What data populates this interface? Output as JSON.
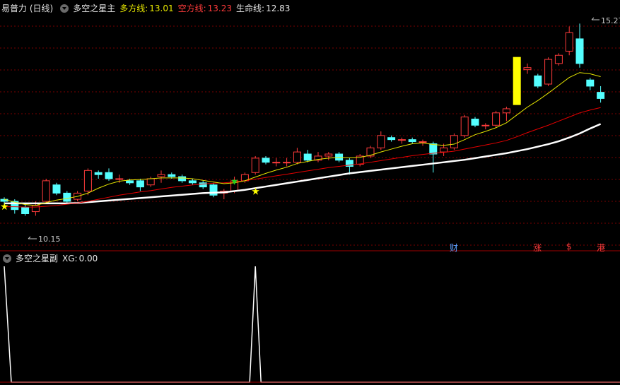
{
  "main_legend": {
    "title": "易普力 (日线)",
    "indicator": "多空之星主",
    "long_label": "多方线:",
    "long_value": "13.01",
    "short_label": "空方线:",
    "short_value": "13.23",
    "life_label": "生命线:",
    "life_value": "12.83"
  },
  "sub_legend": {
    "indicator": "多空之星副",
    "xg_label": "XG:",
    "xg_value": "0.00"
  },
  "price_labels": {
    "high": "15.27",
    "low": "10.15"
  },
  "event_tags": [
    {
      "text": "财",
      "color": "#5aa0ff"
    },
    {
      "text": "涨",
      "color": "#ff3b3b"
    },
    {
      "text": "$",
      "color": "#ff3b3b"
    },
    {
      "text": "港",
      "color": "#ff3b3b"
    }
  ],
  "colors": {
    "up": "#ff3b3b",
    "down": "#54ffff",
    "long_line": "#e6e600",
    "short_line": "#e60000",
    "life_line": "#ffffff",
    "grid": "#7a0000"
  },
  "chart_data": {
    "type": "candlestick",
    "y_range": [
      9.8,
      15.5
    ],
    "candles": [
      [
        11.0,
        10.95,
        10.85,
        11.05
      ],
      [
        10.95,
        10.75,
        10.65,
        11.0
      ],
      [
        10.8,
        10.65,
        10.6,
        10.9
      ],
      [
        10.7,
        10.85,
        10.6,
        10.95
      ],
      [
        10.95,
        11.45,
        10.9,
        11.5
      ],
      [
        11.35,
        11.15,
        11.1,
        11.4
      ],
      [
        11.15,
        10.95,
        10.9,
        11.2
      ],
      [
        11.0,
        11.15,
        10.95,
        11.2
      ],
      [
        11.2,
        11.7,
        11.1,
        11.75
      ],
      [
        11.65,
        11.6,
        11.5,
        11.7
      ],
      [
        11.65,
        11.5,
        11.45,
        11.75
      ],
      [
        11.5,
        11.5,
        11.4,
        11.6
      ],
      [
        11.45,
        11.4,
        11.35,
        11.5
      ],
      [
        11.45,
        11.3,
        11.2,
        11.5
      ],
      [
        11.35,
        11.5,
        11.3,
        11.55
      ],
      [
        11.55,
        11.6,
        11.4,
        11.7
      ],
      [
        11.6,
        11.55,
        11.5,
        11.65
      ],
      [
        11.55,
        11.45,
        11.4,
        11.6
      ],
      [
        11.45,
        11.4,
        11.35,
        11.5
      ],
      [
        11.4,
        11.3,
        11.25,
        11.45
      ],
      [
        11.35,
        11.1,
        11.05,
        11.4
      ],
      [
        11.15,
        11.2,
        11.0,
        11.25
      ],
      [
        11.2,
        11.45,
        11.15,
        11.55
      ],
      [
        11.45,
        11.6,
        11.4,
        11.65
      ],
      [
        11.65,
        12.0,
        11.6,
        12.05
      ],
      [
        12.0,
        11.9,
        11.85,
        12.05
      ],
      [
        11.9,
        11.9,
        11.8,
        12.0
      ],
      [
        11.9,
        11.9,
        11.8,
        12.0
      ],
      [
        11.9,
        12.15,
        11.85,
        12.25
      ],
      [
        12.1,
        11.95,
        11.9,
        12.2
      ],
      [
        11.95,
        12.05,
        11.9,
        12.15
      ],
      [
        12.05,
        12.1,
        11.95,
        12.15
      ],
      [
        12.1,
        11.95,
        11.9,
        12.15
      ],
      [
        11.95,
        11.8,
        11.6,
        12.0
      ],
      [
        11.85,
        12.05,
        11.8,
        12.1
      ],
      [
        12.05,
        12.25,
        12.0,
        12.3
      ],
      [
        12.25,
        12.55,
        12.2,
        12.65
      ],
      [
        12.5,
        12.45,
        12.4,
        12.55
      ],
      [
        12.45,
        12.45,
        12.35,
        12.5
      ],
      [
        12.45,
        12.4,
        12.35,
        12.5
      ],
      [
        12.4,
        12.4,
        12.3,
        12.45
      ],
      [
        12.35,
        12.1,
        11.65,
        12.4
      ],
      [
        12.15,
        12.25,
        12.05,
        12.35
      ],
      [
        12.25,
        12.55,
        12.2,
        12.6
      ],
      [
        12.55,
        13.0,
        12.5,
        13.05
      ],
      [
        12.95,
        12.8,
        12.75,
        13.0
      ],
      [
        12.8,
        12.8,
        12.7,
        12.85
      ],
      [
        12.8,
        13.1,
        12.75,
        13.15
      ],
      [
        13.1,
        13.2,
        12.9,
        13.25
      ],
      [
        13.3,
        14.45,
        13.3,
        14.45
      ],
      [
        14.15,
        14.2,
        14.05,
        14.3
      ],
      [
        14.0,
        13.75,
        13.7,
        14.05
      ],
      [
        13.8,
        14.4,
        13.75,
        14.45
      ],
      [
        14.3,
        14.5,
        14.25,
        14.55
      ],
      [
        14.6,
        15.05,
        14.5,
        15.2
      ],
      [
        14.9,
        14.3,
        14.2,
        15.27
      ],
      [
        13.9,
        13.75,
        13.65,
        13.95
      ],
      [
        13.6,
        13.45,
        13.35,
        13.75
      ]
    ],
    "long_line": [
      11.0,
      10.93,
      10.87,
      10.85,
      10.92,
      10.98,
      11.02,
      11.07,
      11.15,
      11.27,
      11.37,
      11.44,
      11.47,
      11.48,
      11.5,
      11.52,
      11.52,
      11.52,
      11.5,
      11.46,
      11.42,
      11.38,
      11.4,
      11.45,
      11.54,
      11.63,
      11.71,
      11.78,
      11.87,
      11.92,
      11.97,
      12.0,
      12.02,
      12.01,
      12.02,
      12.07,
      12.15,
      12.22,
      12.29,
      12.35,
      12.37,
      12.33,
      12.31,
      12.34,
      12.45,
      12.57,
      12.65,
      12.74,
      12.86,
      13.05,
      13.24,
      13.4,
      13.58,
      13.77,
      13.96,
      14.08,
      14.05,
      13.98
    ],
    "short_line": [
      10.82,
      10.82,
      10.81,
      10.81,
      10.83,
      10.85,
      10.88,
      10.91,
      10.95,
      11.0,
      11.05,
      11.1,
      11.14,
      11.18,
      11.21,
      11.25,
      11.29,
      11.32,
      11.35,
      11.37,
      11.39,
      11.4,
      11.42,
      11.45,
      11.49,
      11.53,
      11.57,
      11.61,
      11.65,
      11.69,
      11.73,
      11.77,
      11.8,
      11.83,
      11.86,
      11.9,
      11.94,
      11.98,
      12.02,
      12.06,
      12.09,
      12.12,
      12.14,
      12.17,
      12.22,
      12.27,
      12.32,
      12.37,
      12.43,
      12.52,
      12.62,
      12.71,
      12.8,
      12.9,
      13.0,
      13.1,
      13.17,
      13.23
    ],
    "life_line": [
      10.9,
      10.9,
      10.9,
      10.9,
      10.9,
      10.9,
      10.9,
      10.91,
      10.93,
      10.95,
      10.97,
      10.99,
      11.01,
      11.03,
      11.05,
      11.07,
      11.09,
      11.11,
      11.13,
      11.15,
      11.16,
      11.17,
      11.2,
      11.23,
      11.27,
      11.31,
      11.35,
      11.39,
      11.43,
      11.47,
      11.51,
      11.55,
      11.59,
      11.63,
      11.66,
      11.69,
      11.72,
      11.75,
      11.78,
      11.81,
      11.84,
      11.87,
      11.9,
      11.93,
      11.96,
      12.0,
      12.04,
      12.08,
      12.12,
      12.17,
      12.22,
      12.28,
      12.34,
      12.41,
      12.5,
      12.6,
      12.72,
      12.83
    ],
    "markers": [
      {
        "index": 0,
        "type": "star"
      },
      {
        "index": 22,
        "type": "diamond"
      },
      {
        "index": 24,
        "type": "star"
      }
    ],
    "xg_signal": [
      1,
      0,
      0,
      0,
      0,
      0,
      0,
      0,
      0,
      0,
      0,
      0,
      0,
      0,
      0,
      0,
      0,
      0,
      0,
      0,
      0,
      0,
      0,
      0,
      1,
      0,
      0,
      0,
      0,
      0,
      0,
      0,
      0,
      0,
      0,
      0,
      0,
      0,
      0,
      0,
      0,
      0,
      0,
      0,
      0,
      0,
      0,
      0,
      0,
      0,
      0,
      0,
      0,
      0,
      0,
      0,
      0,
      0
    ]
  }
}
